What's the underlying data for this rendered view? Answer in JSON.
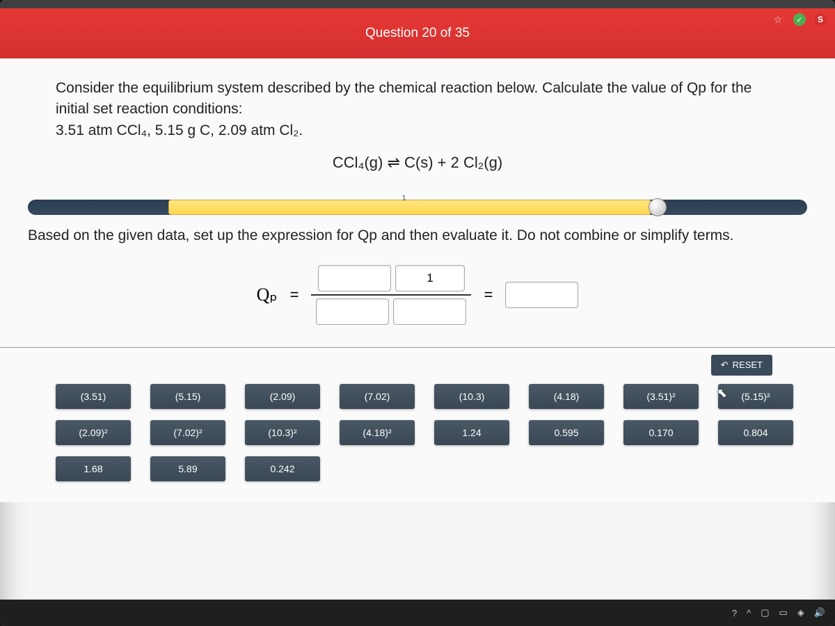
{
  "header": {
    "question_counter": "Question 20 of 35"
  },
  "question": {
    "prompt_line1": "Consider the equilibrium system described by the chemical reaction below. Calculate the value of Qp for the initial set reaction conditions:",
    "prompt_line2": "3.51 atm CCl₄, 5.15 g C, 2.09 atm Cl₂.",
    "equation": "CCl₄(g) ⇌ C(s) + 2 Cl₂(g)"
  },
  "slider": {
    "tick": "1"
  },
  "instruction": "Based on the given data, set up the expression for Qp and then evaluate it. Do not combine or simplify terms.",
  "expression": {
    "lhs": "Qₚ",
    "eq1": "=",
    "numerator_fixed": "1",
    "eq2": "="
  },
  "reset": {
    "label": "RESET"
  },
  "tiles": {
    "row1": [
      "(3.51)",
      "(5.15)",
      "(2.09)",
      "(7.02)",
      "(10.3)",
      "(4.18)",
      "(3.51)²",
      "(5.15)²"
    ],
    "row2": [
      "(2.09)²",
      "(7.02)²",
      "(10.3)²",
      "(4.18)²",
      "1.24",
      "0.595",
      "0.170",
      "0.804"
    ],
    "row3": [
      "1.68",
      "5.89",
      "0.242"
    ]
  }
}
